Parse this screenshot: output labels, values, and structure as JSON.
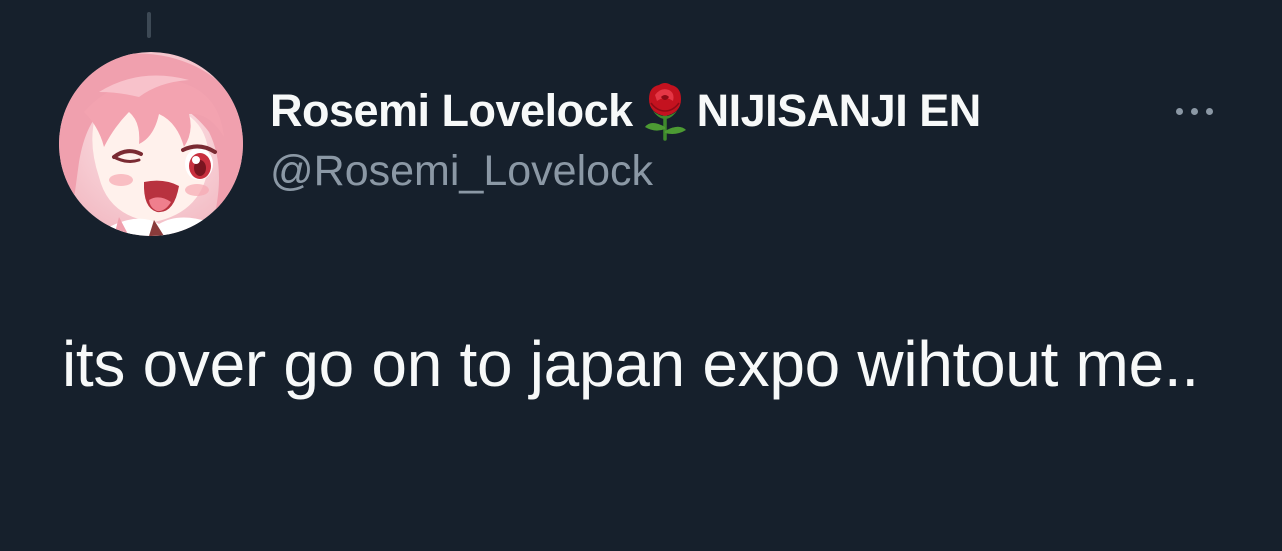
{
  "tweet": {
    "author": {
      "display_name": "Rosemi Lovelock",
      "affiliation": "NIJISANJI EN",
      "handle": "@Rosemi_Lovelock",
      "name_emoji": "rose-icon"
    },
    "text": "its over go on to japan expo wihtout me..",
    "more_icon": "more-horizontal-icon"
  },
  "colors": {
    "background": "#16202c",
    "primary_text": "#f7f9f9",
    "secondary_text": "#8b98a5",
    "thread_line": "#3d4955",
    "avatar_hair": "#f3a3b0",
    "rose_red": "#c4121f"
  }
}
